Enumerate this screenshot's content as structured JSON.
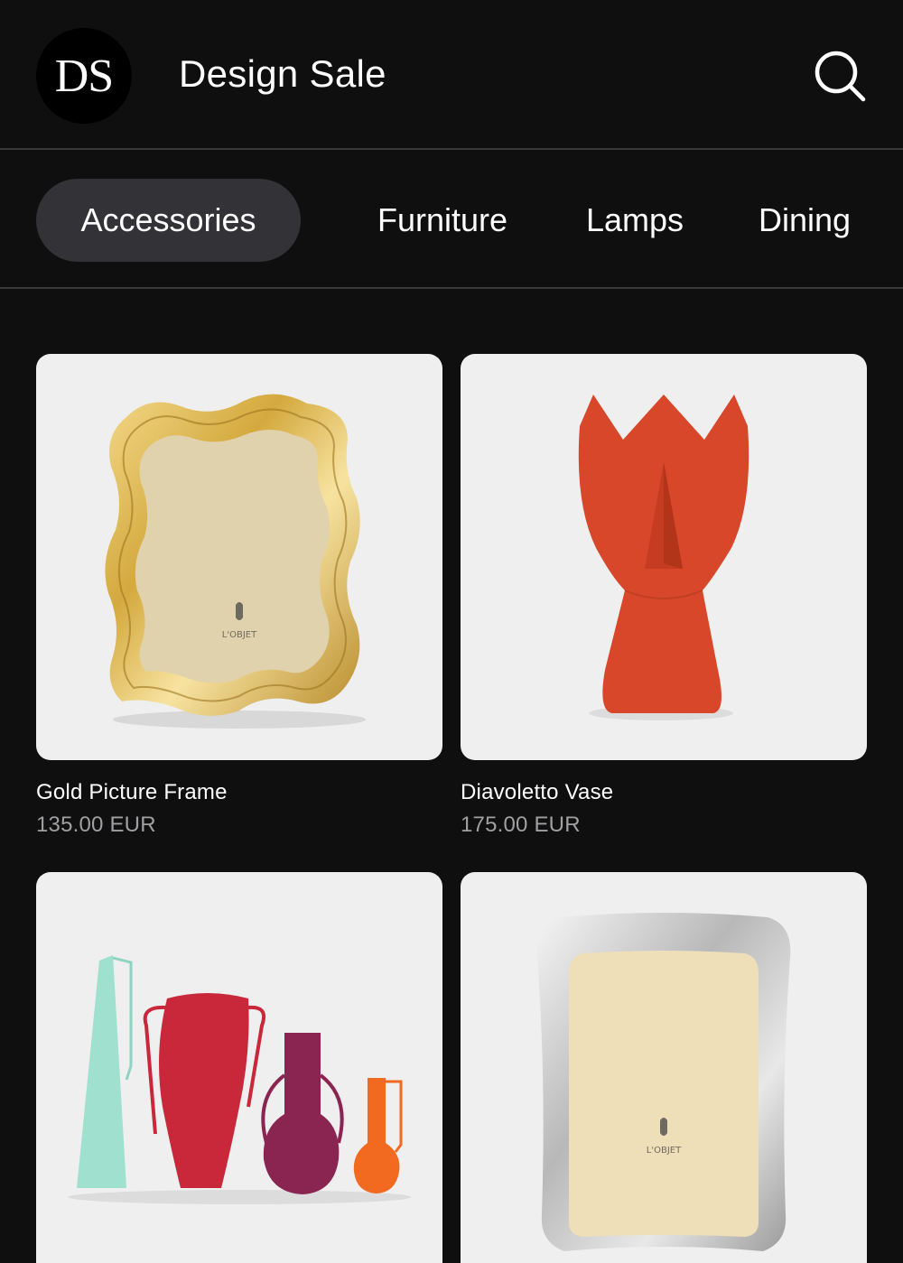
{
  "header": {
    "logo_text": "DS",
    "title": "Design Sale",
    "search_icon": "search-icon"
  },
  "tabs": [
    {
      "label": "Accessories",
      "active": true
    },
    {
      "label": "Furniture",
      "active": false
    },
    {
      "label": "Lamps",
      "active": false
    },
    {
      "label": "Dining",
      "active": false
    }
  ],
  "products": [
    {
      "name": "Gold Picture Frame",
      "price": "135.00 EUR",
      "brand_mark": "L'OBJET"
    },
    {
      "name": "Diavoletto Vase",
      "price": "175.00 EUR"
    },
    {
      "name": "",
      "price": ""
    },
    {
      "name": "",
      "price": "",
      "brand_mark": "L'OBJET"
    }
  ],
  "colors": {
    "background": "#0f0f0f",
    "active_tab": "#333337",
    "divider": "#3a3a3c",
    "card_bg": "#efefef",
    "price_text": "#a0a0a3"
  }
}
